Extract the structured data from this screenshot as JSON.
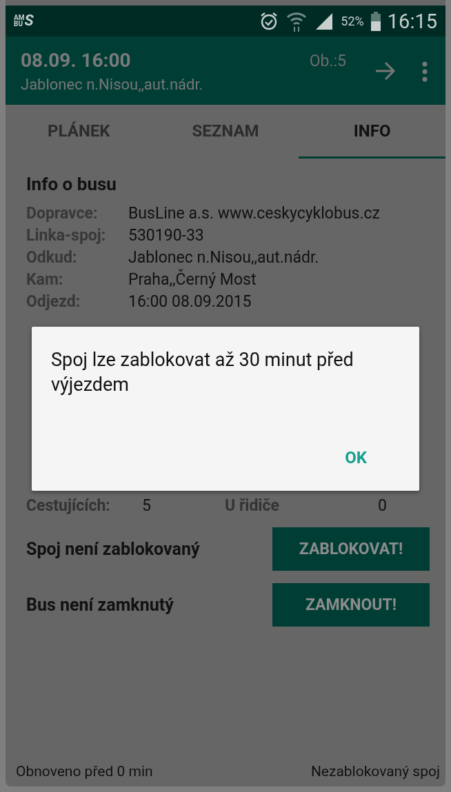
{
  "status_bar": {
    "logo": {
      "top": "AM",
      "bottom": "BU",
      "big": "S"
    },
    "battery": "52%",
    "time": "16:15"
  },
  "toolbar": {
    "datetime": "08.09. 16:00",
    "station": "Jablonec n.Nisou,,aut.nádr.",
    "occupancy": "Ob.:5"
  },
  "tabs": [
    {
      "label": "PLÁNEK",
      "selected": false
    },
    {
      "label": "SEZNAM",
      "selected": false
    },
    {
      "label": "INFO",
      "selected": true
    }
  ],
  "info": {
    "heading": "Info o busu",
    "rows": [
      {
        "label": "Dopravce:",
        "value": "BusLine a.s. www.ceskycyklobus.cz"
      },
      {
        "label": "Linka-spoj:",
        "value": "530190-33"
      },
      {
        "label": "Odkud:",
        "value": "Jablonec n.Nisou,,aut.nádr."
      },
      {
        "label": "Kam:",
        "value": "Praha,,Černý Most"
      },
      {
        "label": "Odjezd:",
        "value": "16:00 08.09.2015"
      }
    ]
  },
  "passengers": {
    "label": "Cestujících:",
    "value": "5",
    "driver_label": "U řidiče",
    "driver_value": "0"
  },
  "actions": [
    {
      "text": "Spoj není zablokovaný",
      "button": "ZABLOKOVAT!"
    },
    {
      "text": "Bus není zamknutý",
      "button": "ZAMKNOUT!"
    }
  ],
  "footer": {
    "left": "Obnoveno před 0 min",
    "right": "Nezablokovaný spoj"
  },
  "dialog": {
    "message": "Spoj lze zablokovat až 30 minut před výjezdem",
    "button": "OK"
  }
}
